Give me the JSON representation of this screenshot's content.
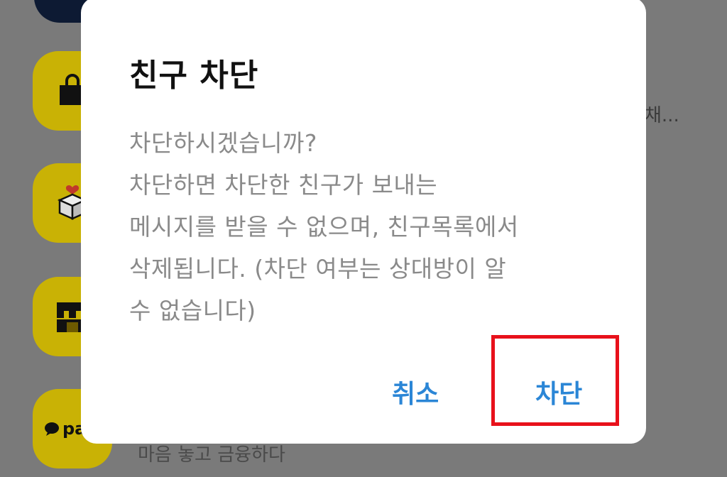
{
  "background": {
    "items": [
      {
        "icon": "bag-icon",
        "text": "채..."
      },
      {
        "icon": "gift-box-icon",
        "text": ""
      },
      {
        "icon": "store-icon",
        "text": ""
      },
      {
        "icon": "pay-icon",
        "label": "pa",
        "text": "마음 놓고 금융하다"
      }
    ]
  },
  "dialog": {
    "title": "친구 차단",
    "body": [
      "차단하시겠습니까?",
      "차단하면 차단한 친구가 보내는",
      "메시지를 받을 수 없으며, 친구목록에서",
      "삭제됩니다. (차단 여부는 상대방이 알",
      "수 없습니다)"
    ],
    "cancel_label": "취소",
    "confirm_label": "차단"
  },
  "colors": {
    "accent": "#2b86d6",
    "highlight": "#e8111b",
    "icon_bg": "#f5d800"
  }
}
